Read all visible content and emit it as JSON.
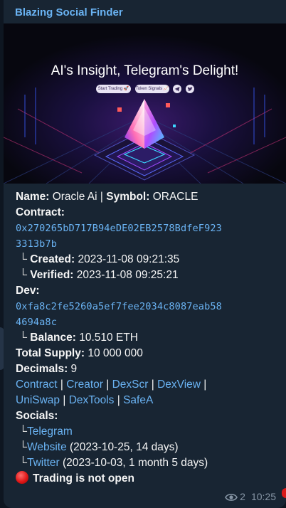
{
  "message": {
    "sender": "Blazing Social Finder",
    "banner": {
      "title": "AI's Insight, Telegram's Delight!",
      "button1": "Start Trading 🚀",
      "button2": "Token Signals 📈",
      "icons": [
        "telegram-icon",
        "twitter-icon"
      ]
    },
    "name_label": "Name:",
    "name_value": "Oracle Ai",
    "pipe": "|",
    "symbol_label": "Symbol:",
    "symbol_value": "ORACLE",
    "contract_label": "Contract:",
    "contract_address_line1": "0x270265bD717B94eDE02EB2578BdfeF923",
    "contract_address_line2": "3313b7b",
    "tree_glyph": "└",
    "created_label": "Created:",
    "created_value": "2023-11-08 09:21:35",
    "verified_label": "Verified:",
    "verified_value": "2023-11-08 09:25:21",
    "dev_label": "Dev:",
    "dev_address_line1": "0xfa8c2fe5260a5ef7fee2034c8087eab58",
    "dev_address_line2": "4694a8c",
    "balance_label": "Balance:",
    "balance_value": "10.510 ETH",
    "total_supply_label": "Total Supply:",
    "total_supply_value": "10 000 000",
    "decimals_label": "Decimals:",
    "decimals_value": "9",
    "links": {
      "contract": "Contract",
      "creator": "Creator",
      "dexscr": "DexScr",
      "dexview": "DexView",
      "uniswap": "UniSwap",
      "dextools": "DexTools",
      "safea": "SafeA"
    },
    "socials_label": "Socials:",
    "socials": {
      "telegram": "Telegram",
      "website": "Website",
      "website_note": "(2023-10-25, 14 days)",
      "twitter": "Twitter",
      "twitter_note": "(2023-10-03, 1 month 5 days)"
    },
    "trading_status": "Trading is not open",
    "views": "2",
    "time": "10:25"
  },
  "colors": {
    "chat_background": "#0e1621",
    "bubble_background": "#182533",
    "link": "#6ab3f3",
    "text": "#f5f5f5",
    "meta": "#8796a6",
    "status_dot": "#e01818"
  }
}
